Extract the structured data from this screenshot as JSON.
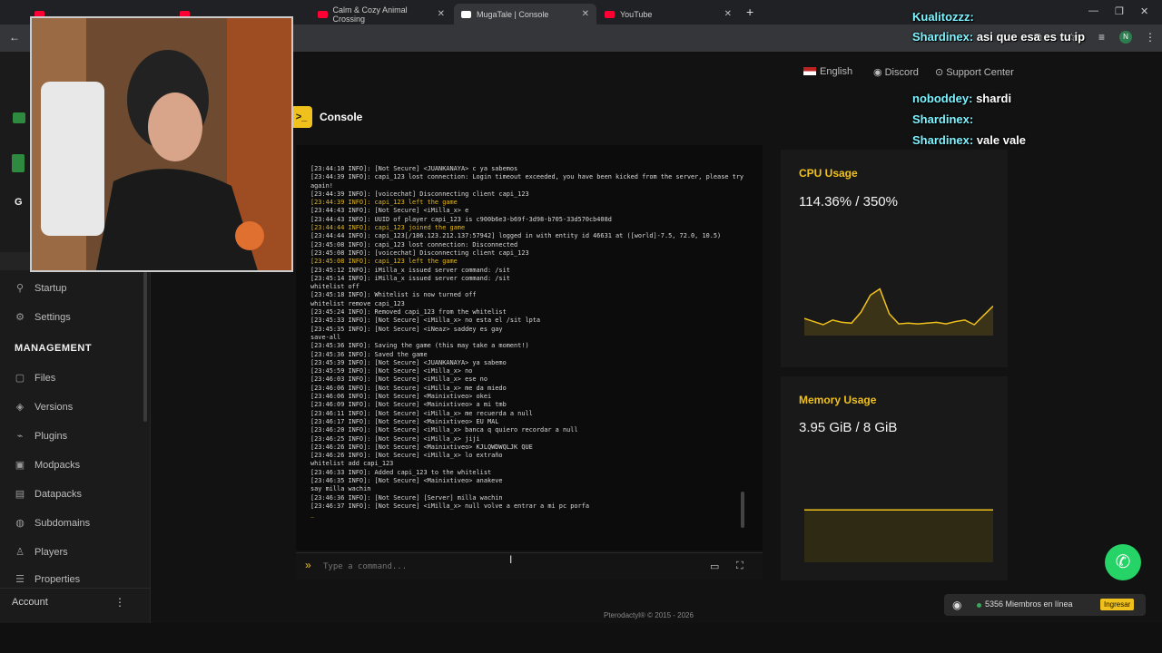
{
  "browser": {
    "tabs": [
      {
        "label": "",
        "active": false
      },
      {
        "label": "",
        "active": false
      },
      {
        "label": "Calm & Cozy Animal Crossing",
        "active": false
      },
      {
        "label": "MugaTale | Console",
        "active": true
      },
      {
        "label": "YouTube",
        "active": false
      }
    ],
    "new_tab": "+",
    "profile_initial": "N"
  },
  "topnav": {
    "language": "English",
    "discord": "Discord",
    "support": "Support Center"
  },
  "sidebar": {
    "items_top": [
      {
        "label": "Startup",
        "icon": "rocket-icon"
      },
      {
        "label": "Settings",
        "icon": "gear-icon"
      }
    ],
    "management_header": "MANAGEMENT",
    "items": [
      {
        "label": "Files",
        "icon": "file-icon"
      },
      {
        "label": "Versions",
        "icon": "layers-icon"
      },
      {
        "label": "Plugins",
        "icon": "plug-icon"
      },
      {
        "label": "Modpacks",
        "icon": "box-icon"
      },
      {
        "label": "Datapacks",
        "icon": "database-icon"
      },
      {
        "label": "Subdomains",
        "icon": "globe-icon"
      },
      {
        "label": "Players",
        "icon": "user-icon"
      },
      {
        "label": "Properties",
        "icon": "list-icon"
      }
    ],
    "account": "Account",
    "partial_header": "G"
  },
  "console": {
    "title": "Console",
    "placeholder": "Type a command...",
    "prompt": "»",
    "lines": [
      {
        "t": "[23:44:10 INFO]: [Not Secure] <JUANKANAYA> c ya sabemos",
        "y": false
      },
      {
        "t": "[23:44:39 INFO]: capi_123 lost connection: Login timeout exceeded, you have been kicked from the server, please try again!",
        "y": false
      },
      {
        "t": "[23:44:39 INFO]: [voicechat] Disconnecting client capi_123",
        "y": false
      },
      {
        "t": "[23:44:39 INFO]: capi_123 left the game",
        "y": true
      },
      {
        "t": "[23:44:43 INFO]: [Not Secure] <iMilla_x> e",
        "y": false
      },
      {
        "t": "[23:44:43 INFO]: UUID of player capi_123 is c900b6e3-b69f-3d98-b705-33d570cb408d",
        "y": false
      },
      {
        "t": "[23:44:44 INFO]: capi_123 joined the game",
        "y": true
      },
      {
        "t": "[23:44:44 INFO]: capi_123[/186.123.212.137:57942] logged in with entity id 46631 at ([world]-7.5, 72.0, 10.5)",
        "y": false
      },
      {
        "t": "[23:45:08 INFO]: capi_123 lost connection: Disconnected",
        "y": false
      },
      {
        "t": "[23:45:08 INFO]: [voicechat] Disconnecting client capi_123",
        "y": false
      },
      {
        "t": "[23:45:08 INFO]: capi_123 left the game",
        "y": true
      },
      {
        "t": "[23:45:12 INFO]: iMilla_x issued server command: /sit",
        "y": false
      },
      {
        "t": "[23:45:14 INFO]: iMilla_x issued server command: /sit",
        "y": false
      },
      {
        "t": "whitelist off",
        "y": false
      },
      {
        "t": "[23:45:18 INFO]: Whitelist is now turned off",
        "y": false
      },
      {
        "t": "whitelist remove capi_123",
        "y": false
      },
      {
        "t": "[23:45:24 INFO]: Removed capi_123 from the whitelist",
        "y": false
      },
      {
        "t": "[23:45:33 INFO]: [Not Secure] <iMilla_x> no esta el /sit lpta",
        "y": false
      },
      {
        "t": "[23:45:35 INFO]: [Not Secure] <iNeaz> saddey es gay",
        "y": false
      },
      {
        "t": "save-all",
        "y": false
      },
      {
        "t": "[23:45:36 INFO]: Saving the game (this may take a moment!)",
        "y": false
      },
      {
        "t": "[23:45:36 INFO]: Saved the game",
        "y": false
      },
      {
        "t": "[23:45:39 INFO]: [Not Secure] <JUANKANAYA> ya sabemo",
        "y": false
      },
      {
        "t": "[23:45:59 INFO]: [Not Secure] <iMilla_x> no",
        "y": false
      },
      {
        "t": "[23:46:03 INFO]: [Not Secure] <iMilla_x> ese no",
        "y": false
      },
      {
        "t": "[23:46:06 INFO]: [Not Secure] <iMilla_x> me da miedo",
        "y": false
      },
      {
        "t": "[23:46:06 INFO]: [Not Secure] <Mainixtiveo> okei",
        "y": false
      },
      {
        "t": "[23:46:09 INFO]: [Not Secure] <Mainixtiveo> a mi tmb",
        "y": false
      },
      {
        "t": "[23:46:11 INFO]: [Not Secure] <iMilla_x> me recuerda a null",
        "y": false
      },
      {
        "t": "[23:46:17 INFO]: [Not Secure] <Mainixtiveo> EU MAL",
        "y": false
      },
      {
        "t": "[23:46:20 INFO]: [Not Secure] <iMilla_x> banca q quiero recordar a null",
        "y": false
      },
      {
        "t": "[23:46:25 INFO]: [Not Secure] <iMilla_x> jiji",
        "y": false
      },
      {
        "t": "[23:46:26 INFO]: [Not Secure] <Mainixtiveo> KJLQWDWQLJK QUE",
        "y": false
      },
      {
        "t": "[23:46:26 INFO]: [Not Secure] <iMilla_x> lo extraño",
        "y": false
      },
      {
        "t": "whitelist add capi_123",
        "y": false
      },
      {
        "t": "[23:46:33 INFO]: Added capi_123 to the whitelist",
        "y": false
      },
      {
        "t": "[23:46:35 INFO]: [Not Secure] <Mainixtiveo> anakeve",
        "y": false
      },
      {
        "t": "say milla wachin",
        "y": false
      },
      {
        "t": "[23:46:36 INFO]: [Not Secure] [Server] milla wachin",
        "y": false
      },
      {
        "t": "[23:46:37 INFO]: [Not Secure] <iMilla_x> null volve a entrar a mi pc porfa",
        "y": false
      },
      {
        "t": "_",
        "y": true
      }
    ]
  },
  "cpu": {
    "title": "CPU Usage",
    "value": "114.36% / 350%",
    "history": [
      22,
      18,
      14,
      20,
      17,
      16,
      30,
      52,
      60,
      28,
      15,
      16,
      15,
      16,
      17,
      15,
      18,
      20,
      14,
      26,
      38
    ]
  },
  "memory": {
    "title": "Memory Usage",
    "value": "3.95 GiB / 8 GiB",
    "fraction": 0.49
  },
  "footer": {
    "text": "Pterodactyl® © 2015 - 2026"
  },
  "discord_widget": {
    "members": "5356 Miembros en línea",
    "join": "Ingresar"
  },
  "stream_chat": [
    {
      "name": "Kualitozzz:",
      "msg": ""
    },
    {
      "name": "Shardinex:",
      "msg": "asi que esa es tu ip"
    },
    {
      "name": "noboddey:",
      "msg": "shardi"
    },
    {
      "name": "Shardinex:",
      "msg": ""
    },
    {
      "name": "Shardinex:",
      "msg": "vale vale"
    }
  ],
  "colors": {
    "accent": "#f0c11c",
    "bg": "#121212",
    "card": "#191919",
    "whatsapp": "#25d366"
  }
}
